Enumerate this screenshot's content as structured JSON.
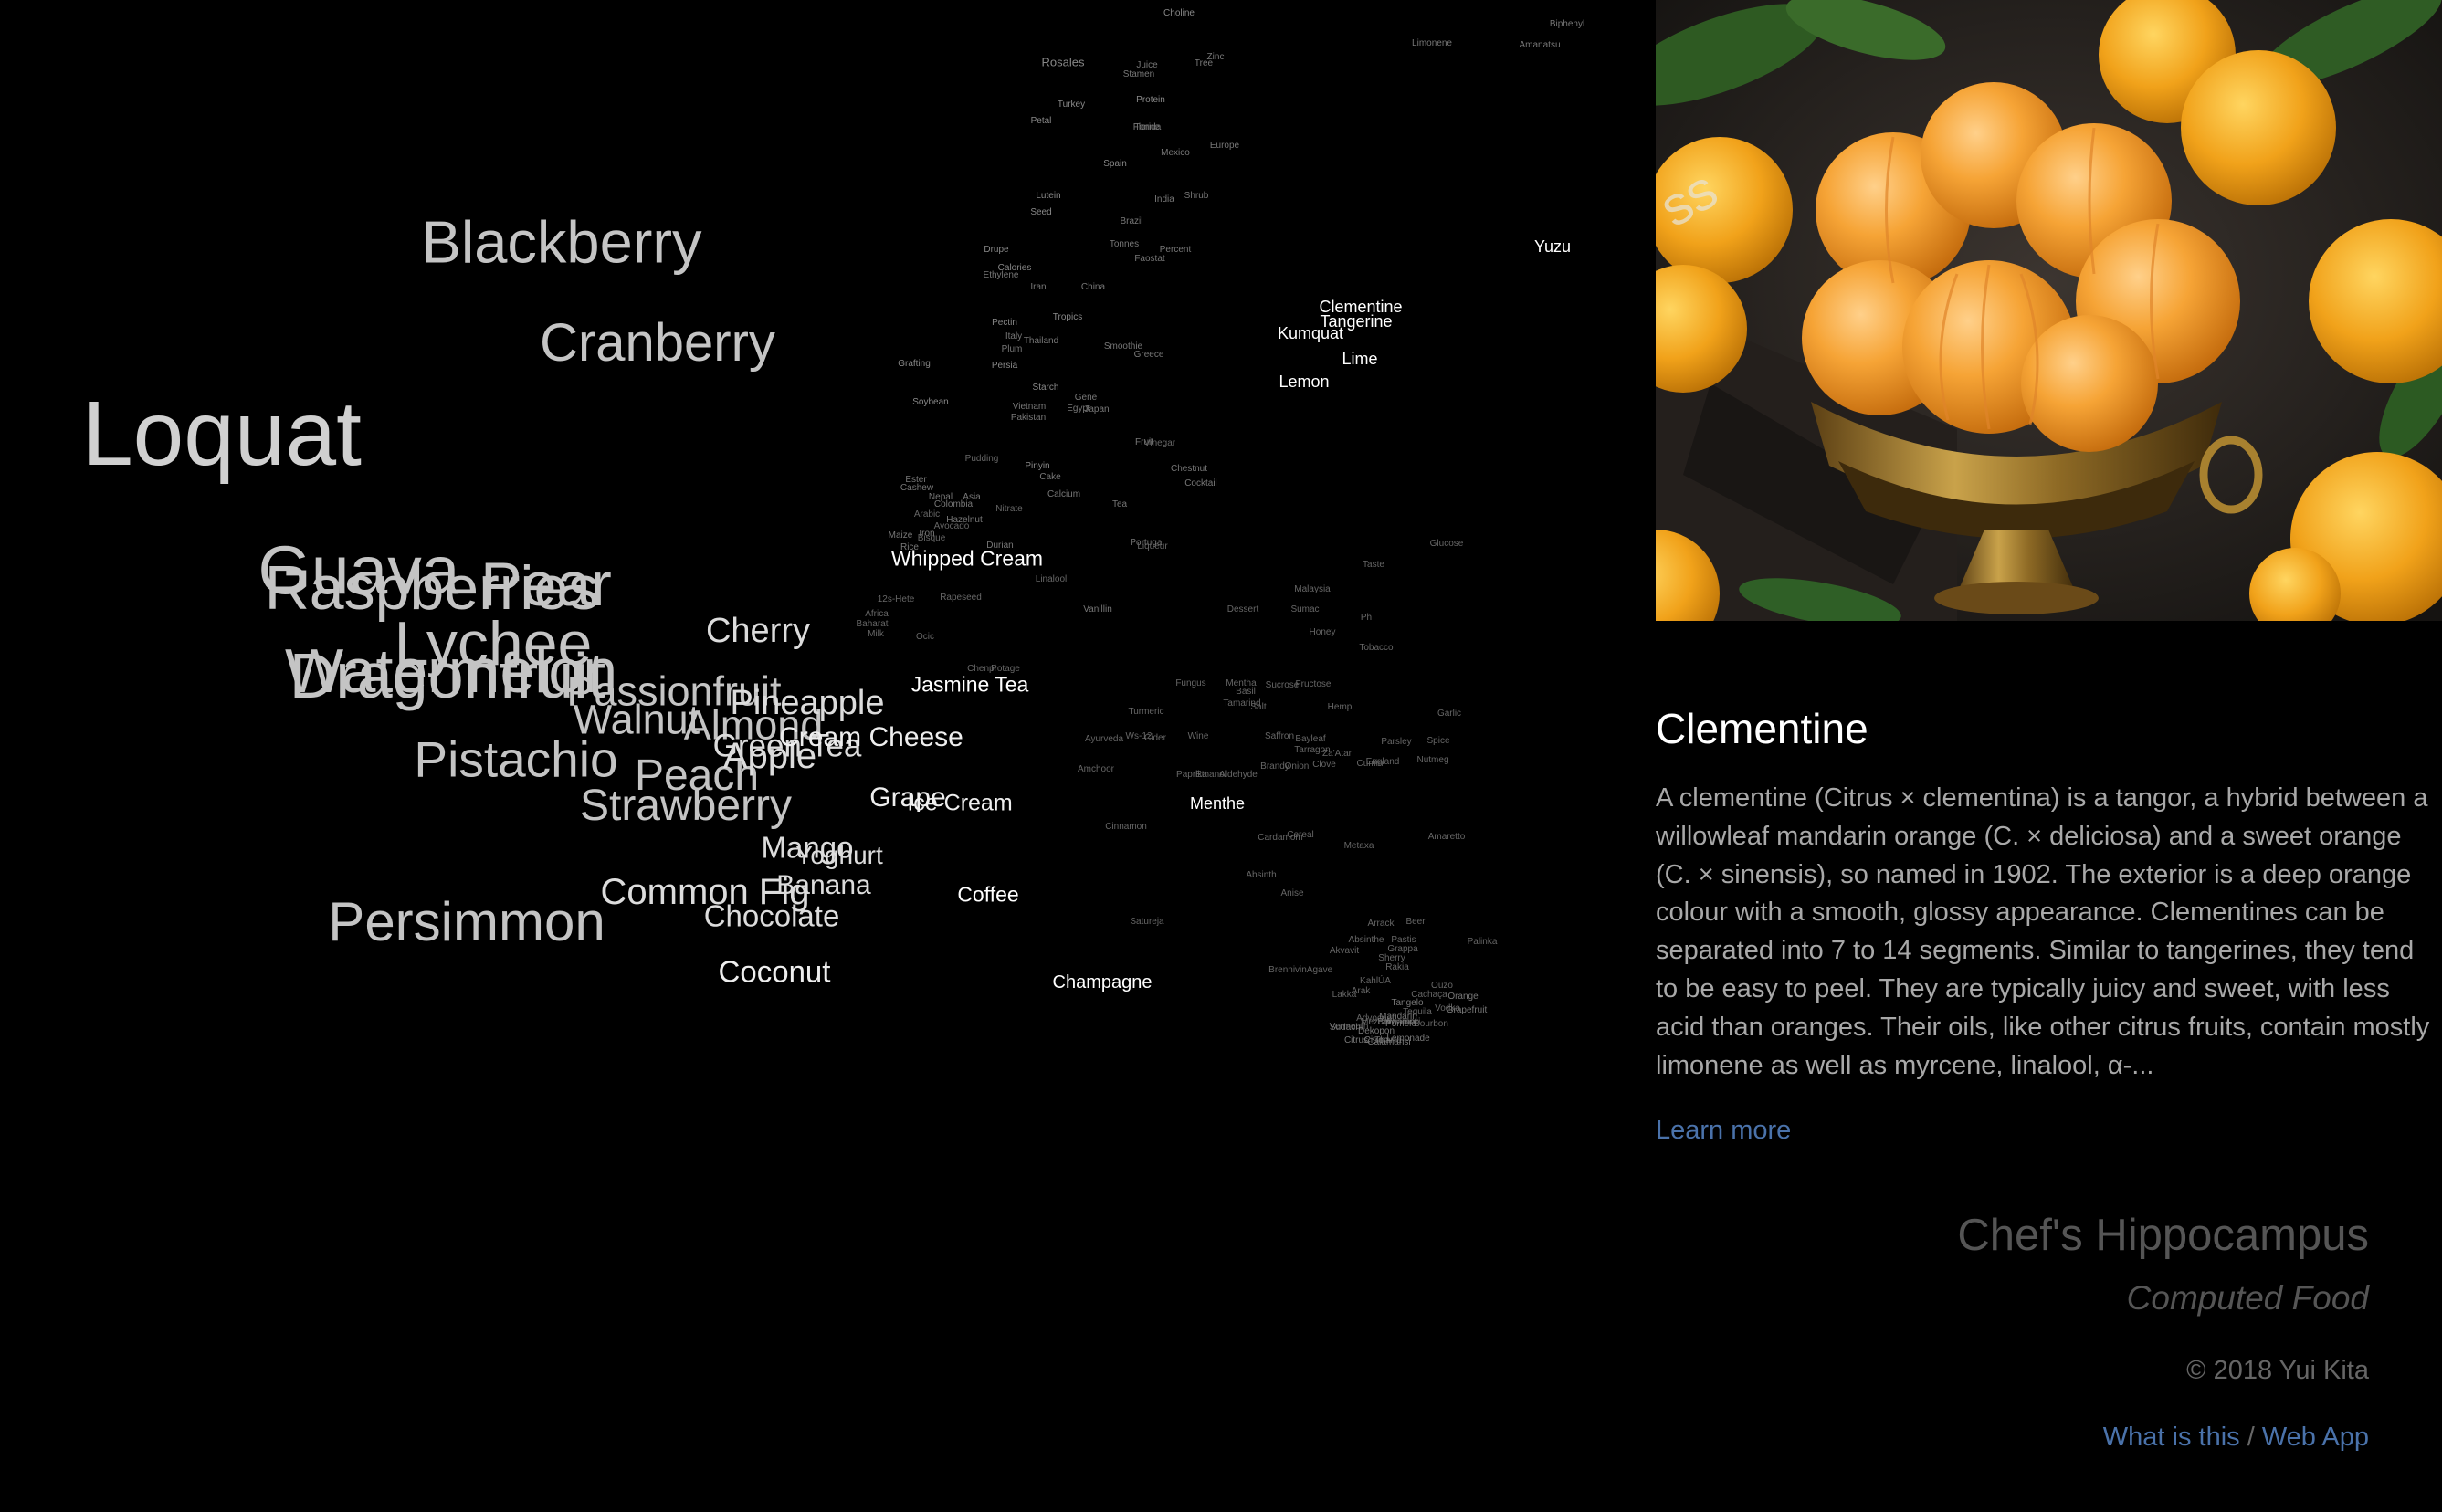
{
  "cloud": {
    "words": [
      {
        "t": "Loquat",
        "s": 0.4,
        "c": "#d0d0d0"
      },
      {
        "t": "Blackberry",
        "s": 0.26,
        "c": "#c4c4c4"
      },
      {
        "t": "Cranberry",
        "s": 0.23,
        "c": "#c4c4c4"
      },
      {
        "t": "Guava",
        "s": 0.3,
        "c": "#c4c4c4"
      },
      {
        "t": "Pear",
        "s": 0.27,
        "c": "#c4c4c4"
      },
      {
        "t": "Raspberries",
        "s": 0.27,
        "c": "#c4c4c4"
      },
      {
        "t": "Lychee",
        "s": 0.27,
        "c": "#c4c4c4"
      },
      {
        "t": "Watermelon",
        "s": 0.27,
        "c": "#c4c4c4"
      },
      {
        "t": "Dragonfruit",
        "s": 0.28,
        "c": "#c4c4c4"
      },
      {
        "t": "Passionfruit",
        "s": 0.18,
        "c": "#c4c4c4"
      },
      {
        "t": "Walnut",
        "s": 0.18,
        "c": "#c4c4c4"
      },
      {
        "t": "Almond",
        "s": 0.18,
        "c": "#c4c4c4"
      },
      {
        "t": "Pistachio",
        "s": 0.22,
        "c": "#c4c4c4"
      },
      {
        "t": "Peach",
        "s": 0.19,
        "c": "#c4c4c4"
      },
      {
        "t": "Strawberry",
        "s": 0.19,
        "c": "#c4c4c4"
      },
      {
        "t": "Persimmon",
        "s": 0.24,
        "c": "#c4c4c4"
      },
      {
        "t": "Cherry",
        "s": 0.15,
        "c": "#dcdcdc"
      },
      {
        "t": "Pineapple",
        "s": 0.15,
        "c": "#dcdcdc"
      },
      {
        "t": "Green Tea",
        "s": 0.14,
        "c": "#dcdcdc"
      },
      {
        "t": "Apple",
        "s": 0.16,
        "c": "#dcdcdc"
      },
      {
        "t": "Cream Cheese",
        "s": 0.12,
        "c": "#eeeeee"
      },
      {
        "t": "Grape",
        "s": 0.12,
        "c": "#eeeeee"
      },
      {
        "t": "Ice Cream",
        "s": 0.1,
        "c": "#eeeeee"
      },
      {
        "t": "Mango",
        "s": 0.13,
        "c": "#dcdcdc"
      },
      {
        "t": "Yoghurt",
        "s": 0.11,
        "c": "#dcdcdc"
      },
      {
        "t": "Banana",
        "s": 0.12,
        "c": "#dcdcdc"
      },
      {
        "t": "Common Fig",
        "s": 0.16,
        "c": "#dcdcdc"
      },
      {
        "t": "Chocolate",
        "s": 0.13,
        "c": "#dcdcdc"
      },
      {
        "t": "Coconut",
        "s": 0.13,
        "c": "#eeeeee"
      },
      {
        "t": "Whipped Cream",
        "s": 0.09,
        "c": "#ffffff"
      },
      {
        "t": "Jasmine Tea",
        "s": 0.09,
        "c": "#ffffff"
      },
      {
        "t": "Coffee",
        "s": 0.09,
        "c": "#ffffff"
      },
      {
        "t": "Champagne",
        "s": 0.08,
        "c": "#ffffff"
      },
      {
        "t": "Menthe",
        "s": 0.07,
        "c": "#ffffff"
      },
      {
        "t": "Clementine",
        "s": 0.07,
        "c": "#ffffff"
      },
      {
        "t": "Tangerine",
        "s": 0.07,
        "c": "#ffffff"
      },
      {
        "t": "Kumquat",
        "s": 0.07,
        "c": "#ffffff"
      },
      {
        "t": "Lime",
        "s": 0.07,
        "c": "#ffffff"
      },
      {
        "t": "Lemon",
        "s": 0.07,
        "c": "#ffffff"
      },
      {
        "t": "Yuzu",
        "s": 0.07,
        "c": "#ffffff"
      },
      {
        "t": "Choline",
        "s": 0.04,
        "c": "#888888"
      },
      {
        "t": "Rosales",
        "s": 0.05,
        "c": "#888888"
      },
      {
        "t": "Juice",
        "s": 0.04,
        "c": "#777777"
      },
      {
        "t": "Stamen",
        "s": 0.04,
        "c": "#777777"
      },
      {
        "t": "Zinc",
        "s": 0.04,
        "c": "#777777"
      },
      {
        "t": "Tree",
        "s": 0.04,
        "c": "#777777"
      },
      {
        "t": "Turkey",
        "s": 0.04,
        "c": "#888888"
      },
      {
        "t": "Petal",
        "s": 0.04,
        "c": "#888888"
      },
      {
        "t": "Protein",
        "s": 0.04,
        "c": "#888888"
      },
      {
        "t": "Florida",
        "s": 0.04,
        "c": "#777777"
      },
      {
        "t": "Tonne",
        "s": 0.04,
        "c": "#777777"
      },
      {
        "t": "Europe",
        "s": 0.04,
        "c": "#777777"
      },
      {
        "t": "Mexico",
        "s": 0.04,
        "c": "#777777"
      },
      {
        "t": "Spain",
        "s": 0.04,
        "c": "#888888"
      },
      {
        "t": "Lutein",
        "s": 0.04,
        "c": "#888888"
      },
      {
        "t": "Seed",
        "s": 0.04,
        "c": "#888888"
      },
      {
        "t": "India",
        "s": 0.04,
        "c": "#777777"
      },
      {
        "t": "Shrub",
        "s": 0.04,
        "c": "#777777"
      },
      {
        "t": "Brazil",
        "s": 0.04,
        "c": "#777777"
      },
      {
        "t": "Drupe",
        "s": 0.04,
        "c": "#888888"
      },
      {
        "t": "Calories",
        "s": 0.04,
        "c": "#888888"
      },
      {
        "t": "Ethylene",
        "s": 0.04,
        "c": "#777777"
      },
      {
        "t": "Iran",
        "s": 0.04,
        "c": "#777777"
      },
      {
        "t": "Tonnes",
        "s": 0.04,
        "c": "#777777"
      },
      {
        "t": "Percent",
        "s": 0.04,
        "c": "#777777"
      },
      {
        "t": "Faostat",
        "s": 0.04,
        "c": "#777777"
      },
      {
        "t": "China",
        "s": 0.04,
        "c": "#777777"
      },
      {
        "t": "Pectin",
        "s": 0.04,
        "c": "#888888"
      },
      {
        "t": "Tropics",
        "s": 0.04,
        "c": "#888888"
      },
      {
        "t": "Italy",
        "s": 0.04,
        "c": "#777777"
      },
      {
        "t": "Thailand",
        "s": 0.04,
        "c": "#777777"
      },
      {
        "t": "Plum",
        "s": 0.04,
        "c": "#777777"
      },
      {
        "t": "Smoothie",
        "s": 0.04,
        "c": "#777777"
      },
      {
        "t": "Greece",
        "s": 0.04,
        "c": "#777777"
      },
      {
        "t": "Grafting",
        "s": 0.04,
        "c": "#888888"
      },
      {
        "t": "Persia",
        "s": 0.04,
        "c": "#888888"
      },
      {
        "t": "Starch",
        "s": 0.04,
        "c": "#888888"
      },
      {
        "t": "Soybean",
        "s": 0.04,
        "c": "#888888"
      },
      {
        "t": "Vietnam",
        "s": 0.04,
        "c": "#777777"
      },
      {
        "t": "Gene",
        "s": 0.04,
        "c": "#777777"
      },
      {
        "t": "Egypt",
        "s": 0.04,
        "c": "#777777"
      },
      {
        "t": "Pakistan",
        "s": 0.04,
        "c": "#777777"
      },
      {
        "t": "Japan",
        "s": 0.04,
        "c": "#777777"
      },
      {
        "t": "Fruit",
        "s": 0.04,
        "c": "#777777"
      },
      {
        "t": "Vinegar",
        "s": 0.04,
        "c": "#666666"
      },
      {
        "t": "Pudding",
        "s": 0.04,
        "c": "#666666"
      },
      {
        "t": "Pinyin",
        "s": 0.04,
        "c": "#888888"
      },
      {
        "t": "Cake",
        "s": 0.04,
        "c": "#777777"
      },
      {
        "t": "Ester",
        "s": 0.04,
        "c": "#777777"
      },
      {
        "t": "Cashew",
        "s": 0.04,
        "c": "#777777"
      },
      {
        "t": "Chestnut",
        "s": 0.04,
        "c": "#777777"
      },
      {
        "t": "Cocktail",
        "s": 0.04,
        "c": "#777777"
      },
      {
        "t": "Calcium",
        "s": 0.04,
        "c": "#777777"
      },
      {
        "t": "Nepal",
        "s": 0.04,
        "c": "#777777"
      },
      {
        "t": "Asia",
        "s": 0.04,
        "c": "#777777"
      },
      {
        "t": "Colombia",
        "s": 0.04,
        "c": "#777777"
      },
      {
        "t": "Nitrate",
        "s": 0.04,
        "c": "#666666"
      },
      {
        "t": "Tea",
        "s": 0.04,
        "c": "#777777"
      },
      {
        "t": "Arabic",
        "s": 0.04,
        "c": "#666666"
      },
      {
        "t": "Hazelnut",
        "s": 0.04,
        "c": "#777777"
      },
      {
        "t": "Iron",
        "s": 0.04,
        "c": "#777777"
      },
      {
        "t": "Bisque",
        "s": 0.04,
        "c": "#666666"
      },
      {
        "t": "Avocado",
        "s": 0.04,
        "c": "#666666"
      },
      {
        "t": "Maize",
        "s": 0.04,
        "c": "#777777"
      },
      {
        "t": "Rice",
        "s": 0.04,
        "c": "#777777"
      },
      {
        "t": "Durian",
        "s": 0.04,
        "c": "#777777"
      },
      {
        "t": "Portugal",
        "s": 0.04,
        "c": "#777777"
      },
      {
        "t": "Liqueur",
        "s": 0.04,
        "c": "#666666"
      },
      {
        "t": "Glucose",
        "s": 0.04,
        "c": "#666666"
      },
      {
        "t": "Taste",
        "s": 0.04,
        "c": "#666666"
      },
      {
        "t": "Linalool",
        "s": 0.04,
        "c": "#666666"
      },
      {
        "t": "12s-Hete",
        "s": 0.04,
        "c": "#666666"
      },
      {
        "t": "Rapeseed",
        "s": 0.04,
        "c": "#666666"
      },
      {
        "t": "Malaysia",
        "s": 0.04,
        "c": "#666666"
      },
      {
        "t": "Vanillin",
        "s": 0.04,
        "c": "#777777"
      },
      {
        "t": "Africa",
        "s": 0.04,
        "c": "#666666"
      },
      {
        "t": "Dessert",
        "s": 0.04,
        "c": "#666666"
      },
      {
        "t": "Sumac",
        "s": 0.04,
        "c": "#666666"
      },
      {
        "t": "Ph",
        "s": 0.04,
        "c": "#666666"
      },
      {
        "t": "Baharat",
        "s": 0.04,
        "c": "#666666"
      },
      {
        "t": "Milk",
        "s": 0.04,
        "c": "#666666"
      },
      {
        "t": "Ocic",
        "s": 0.04,
        "c": "#666666"
      },
      {
        "t": "Honey",
        "s": 0.04,
        "c": "#666666"
      },
      {
        "t": "Tobacco",
        "s": 0.04,
        "c": "#666666"
      },
      {
        "t": "Chenpi",
        "s": 0.04,
        "c": "#666666"
      },
      {
        "t": "Potage",
        "s": 0.04,
        "c": "#666666"
      },
      {
        "t": "Fungus",
        "s": 0.04,
        "c": "#666666"
      },
      {
        "t": "Mentha",
        "s": 0.04,
        "c": "#666666"
      },
      {
        "t": "Sucrose",
        "s": 0.04,
        "c": "#666666"
      },
      {
        "t": "Fructose",
        "s": 0.04,
        "c": "#666666"
      },
      {
        "t": "Basil",
        "s": 0.04,
        "c": "#666666"
      },
      {
        "t": "Tamarind",
        "s": 0.04,
        "c": "#666666"
      },
      {
        "t": "Salt",
        "s": 0.04,
        "c": "#666666"
      },
      {
        "t": "Hemp",
        "s": 0.04,
        "c": "#666666"
      },
      {
        "t": "Turmeric",
        "s": 0.04,
        "c": "#666666"
      },
      {
        "t": "Garlic",
        "s": 0.04,
        "c": "#666666"
      },
      {
        "t": "Ws-12",
        "s": 0.04,
        "c": "#666666"
      },
      {
        "t": "Cider",
        "s": 0.04,
        "c": "#666666"
      },
      {
        "t": "Ayurveda",
        "s": 0.04,
        "c": "#666666"
      },
      {
        "t": "Wine",
        "s": 0.04,
        "c": "#666666"
      },
      {
        "t": "Saffron",
        "s": 0.04,
        "c": "#666666"
      },
      {
        "t": "Bayleaf",
        "s": 0.04,
        "c": "#666666"
      },
      {
        "t": "Parsley",
        "s": 0.04,
        "c": "#666666"
      },
      {
        "t": "Spice",
        "s": 0.04,
        "c": "#666666"
      },
      {
        "t": "Tarragon",
        "s": 0.04,
        "c": "#666666"
      },
      {
        "t": "Za'Atar",
        "s": 0.04,
        "c": "#666666"
      },
      {
        "t": "Amchoor",
        "s": 0.04,
        "c": "#666666"
      },
      {
        "t": "Paprika",
        "s": 0.04,
        "c": "#666666"
      },
      {
        "t": "Ethanol",
        "s": 0.04,
        "c": "#666666"
      },
      {
        "t": "Aldehyde",
        "s": 0.04,
        "c": "#666666"
      },
      {
        "t": "Brandy",
        "s": 0.04,
        "c": "#666666"
      },
      {
        "t": "Onion",
        "s": 0.04,
        "c": "#666666"
      },
      {
        "t": "Clove",
        "s": 0.04,
        "c": "#666666"
      },
      {
        "t": "Cumin",
        "s": 0.04,
        "c": "#666666"
      },
      {
        "t": "England",
        "s": 0.04,
        "c": "#666666"
      },
      {
        "t": "Nutmeg",
        "s": 0.04,
        "c": "#666666"
      },
      {
        "t": "Cinnamon",
        "s": 0.04,
        "c": "#666666"
      },
      {
        "t": "Cardamom",
        "s": 0.04,
        "c": "#666666"
      },
      {
        "t": "Cereal",
        "s": 0.04,
        "c": "#666666"
      },
      {
        "t": "Metaxa",
        "s": 0.04,
        "c": "#666666"
      },
      {
        "t": "Amaretto",
        "s": 0.04,
        "c": "#666666"
      },
      {
        "t": "Absinth",
        "s": 0.04,
        "c": "#666666"
      },
      {
        "t": "Anise",
        "s": 0.04,
        "c": "#666666"
      },
      {
        "t": "Satureja",
        "s": 0.04,
        "c": "#666666"
      },
      {
        "t": "Arrack",
        "s": 0.04,
        "c": "#666666"
      },
      {
        "t": "Beer",
        "s": 0.04,
        "c": "#666666"
      },
      {
        "t": "Absinthe",
        "s": 0.04,
        "c": "#666666"
      },
      {
        "t": "Grappa",
        "s": 0.04,
        "c": "#666666"
      },
      {
        "t": "Palinka",
        "s": 0.04,
        "c": "#666666"
      },
      {
        "t": "Agave",
        "s": 0.04,
        "c": "#666666"
      },
      {
        "t": "Pastis",
        "s": 0.04,
        "c": "#666666"
      },
      {
        "t": "Sherry",
        "s": 0.04,
        "c": "#666666"
      },
      {
        "t": "Brennivin",
        "s": 0.04,
        "c": "#666666"
      },
      {
        "t": "Akvavit",
        "s": 0.04,
        "c": "#666666"
      },
      {
        "t": "Rakia",
        "s": 0.04,
        "c": "#666666"
      },
      {
        "t": "KahlÚA",
        "s": 0.04,
        "c": "#666666"
      },
      {
        "t": "Cachaça",
        "s": 0.04,
        "c": "#666666"
      },
      {
        "t": "Ouzo",
        "s": 0.04,
        "c": "#666666"
      },
      {
        "t": "Arak",
        "s": 0.04,
        "c": "#666666"
      },
      {
        "t": "Vodka",
        "s": 0.04,
        "c": "#666666"
      },
      {
        "t": "Tequila",
        "s": 0.04,
        "c": "#666666"
      },
      {
        "t": "Awamori",
        "s": 0.04,
        "c": "#666666"
      },
      {
        "t": "Vermouth",
        "s": 0.04,
        "c": "#666666"
      },
      {
        "t": "Advocaat",
        "s": 0.04,
        "c": "#666666"
      },
      {
        "t": "Bourbon",
        "s": 0.04,
        "c": "#666666"
      },
      {
        "t": "Mezcal",
        "s": 0.04,
        "c": "#666666"
      },
      {
        "t": "Lakka",
        "s": 0.04,
        "c": "#666666"
      },
      {
        "t": "Tharra",
        "s": 0.04,
        "c": "#666666"
      },
      {
        "t": "Lemonade",
        "s": 0.04,
        "c": "#777777"
      },
      {
        "t": "Orange",
        "s": 0.04,
        "c": "#777777"
      },
      {
        "t": "Tangelo",
        "s": 0.04,
        "c": "#777777"
      },
      {
        "t": "Grapefruit",
        "s": 0.04,
        "c": "#777777"
      },
      {
        "t": "Pomelo",
        "s": 0.04,
        "c": "#777777"
      },
      {
        "t": "Citrus",
        "s": 0.04,
        "c": "#777777"
      },
      {
        "t": "Mandarin",
        "s": 0.04,
        "c": "#777777"
      },
      {
        "t": "Bergamot",
        "s": 0.04,
        "c": "#777777"
      },
      {
        "t": "Citron",
        "s": 0.04,
        "c": "#777777"
      },
      {
        "t": "Sudachi",
        "s": 0.04,
        "c": "#777777"
      },
      {
        "t": "Dekopon",
        "s": 0.04,
        "c": "#777777"
      },
      {
        "t": "Calamansi",
        "s": 0.04,
        "c": "#777777"
      },
      {
        "t": "Limonene",
        "s": 0.04,
        "c": "#777777"
      },
      {
        "t": "Biphenyl",
        "s": 0.04,
        "c": "#777777"
      },
      {
        "t": "Amanatsu",
        "s": 0.04,
        "c": "#777777"
      }
    ]
  },
  "info": {
    "image_alt": "Bowl of peeled clementines",
    "title": "Clementine",
    "description": "A clementine (Citrus × clementina) is a tangor, a hybrid between a willowleaf mandarin orange (C. × deliciosa) and a sweet orange (C. × sinensis), so named in 1902. The exterior is a deep orange colour with a smooth, glossy appearance. Clementines can be separated into 7 to 14 segments. Similar to tangerines, they tend to be easy to peel. They are typically juicy and sweet, with less acid than oranges. Their oils, like other citrus fruits, contain mostly limonene as well as myrcene, linalool, α-...",
    "learn_more": "Learn more"
  },
  "brand": {
    "title": "Chef's Hippocampus",
    "subtitle": "Computed Food",
    "copyright": "© 2018 Yui Kita",
    "link_what": "What is this",
    "separator": "/",
    "link_app": "Web App"
  },
  "colors": {
    "link": "#4a72aa",
    "background": "#000000",
    "accent_orange": "#f29a1c"
  }
}
